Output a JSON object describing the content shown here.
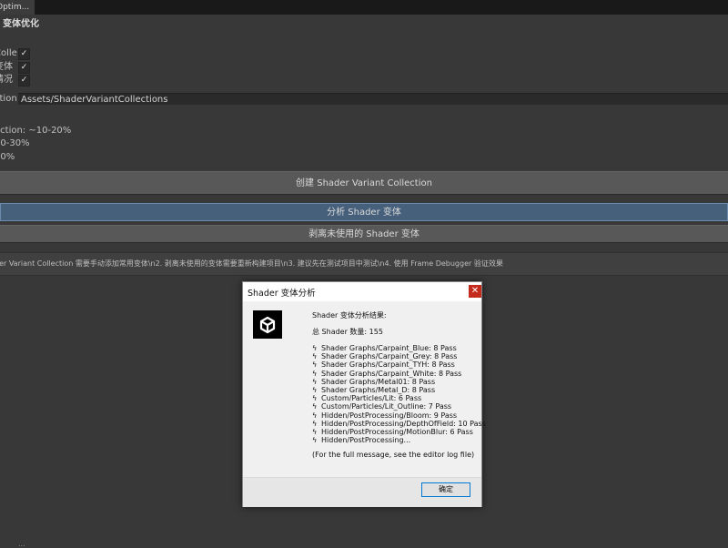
{
  "tab": {
    "label": "Optim..."
  },
  "section_title": "变体优化",
  "toggles": [
    {
      "label": "Colle",
      "checked": true
    },
    {
      "label": "变体",
      "checked": true
    },
    {
      "label": "情况",
      "checked": true
    }
  ],
  "path": {
    "label": "ction",
    "value": "Assets/ShaderVariantCollections"
  },
  "estimates": [
    "ection: ~10-20%",
    "20-30%",
    "50%"
  ],
  "buttons": {
    "create": "创建 Shader Variant Collection",
    "analyze": "分析 Shader 变体",
    "strip": "剥离未使用的 Shader 变体"
  },
  "help_text": "der Variant Collection 需要手动添加常用变体\\n2. 剥离未使用的变体需要重新构建项目\\n3. 建议先在测试项目中测试\\n4. 使用 Frame Debugger 验证效果",
  "bottom_text": "...",
  "dialog": {
    "title": "Shader 变体分析",
    "close_glyph": "✕",
    "heading": "Shader 变体分析结果:",
    "total": "总 Shader 数量: 155",
    "items": [
      "Shader Graphs/Carpaint_Blue: 8 Pass",
      "Shader Graphs/Carpaint_Grey: 8 Pass",
      "Shader Graphs/Carpaint_TYH: 8 Pass",
      "Shader Graphs/Carpaint_White: 8 Pass",
      "Shader Graphs/Metal01: 8 Pass",
      "Shader Graphs/Metal_D: 8 Pass",
      "Custom/Particles/Lit: 6 Pass",
      "Custom/Particles/Lit_Outline: 7 Pass",
      "Hidden/PostProcessing/Bloom: 9 Pass",
      "Hidden/PostProcessing/DepthOfField: 10 Pass",
      "Hidden/PostProcessing/MotionBlur: 6 Pass",
      "Hidden/PostProcessing..."
    ],
    "footer_note": "(For the full message, see the editor log file)",
    "ok_label": "确定",
    "bolt_glyph": "ϟ"
  },
  "colors": {
    "editor_bg": "#383838",
    "analyze_button": "#46607c",
    "close_button": "#c42b1c",
    "ok_border": "#0078d4"
  },
  "icons": {
    "dialog": "unity-logo-icon",
    "close": "close-icon",
    "check": "checkmark-icon",
    "bullet": "lightning-bolt-icon"
  }
}
